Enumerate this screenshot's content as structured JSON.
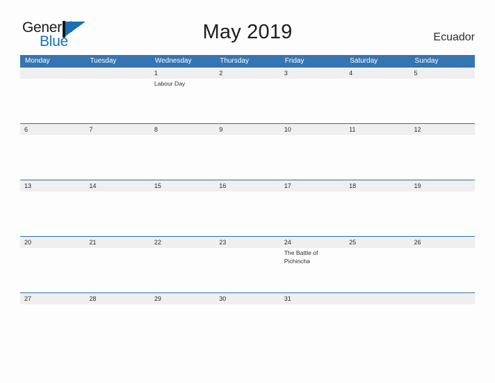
{
  "brand": {
    "word_one": "General",
    "word_two": "Blue",
    "mark_icon": "flag-triangle-icon",
    "accent_color": "#1271bd",
    "dark_color": "#17181c"
  },
  "header": {
    "title": "May 2019",
    "country": "Ecuador"
  },
  "theme": {
    "header_bar_color": "#3575b3",
    "row_rule_color": "#2e6da4",
    "band_color": "#efefef",
    "page_background": "#fdfdfd",
    "text_color": "#2b2b2b"
  },
  "calendar": {
    "weekdays": [
      "Monday",
      "Tuesday",
      "Wednesday",
      "Thursday",
      "Friday",
      "Saturday",
      "Sunday"
    ],
    "weeks": [
      {
        "band_span": 7,
        "days": [
          {
            "num": "",
            "event": ""
          },
          {
            "num": "",
            "event": ""
          },
          {
            "num": "1",
            "event": "Labour Day"
          },
          {
            "num": "2",
            "event": ""
          },
          {
            "num": "3",
            "event": ""
          },
          {
            "num": "4",
            "event": ""
          },
          {
            "num": "5",
            "event": ""
          }
        ]
      },
      {
        "band_span": 7,
        "days": [
          {
            "num": "6",
            "event": ""
          },
          {
            "num": "7",
            "event": ""
          },
          {
            "num": "8",
            "event": ""
          },
          {
            "num": "9",
            "event": ""
          },
          {
            "num": "10",
            "event": ""
          },
          {
            "num": "11",
            "event": ""
          },
          {
            "num": "12",
            "event": ""
          }
        ]
      },
      {
        "band_span": 7,
        "days": [
          {
            "num": "13",
            "event": ""
          },
          {
            "num": "14",
            "event": ""
          },
          {
            "num": "15",
            "event": ""
          },
          {
            "num": "16",
            "event": ""
          },
          {
            "num": "17",
            "event": ""
          },
          {
            "num": "18",
            "event": ""
          },
          {
            "num": "19",
            "event": ""
          }
        ]
      },
      {
        "band_span": 7,
        "days": [
          {
            "num": "20",
            "event": ""
          },
          {
            "num": "21",
            "event": ""
          },
          {
            "num": "22",
            "event": ""
          },
          {
            "num": "23",
            "event": ""
          },
          {
            "num": "24",
            "event": "The Battle of Pichincha"
          },
          {
            "num": "25",
            "event": ""
          },
          {
            "num": "26",
            "event": ""
          }
        ]
      },
      {
        "band_span": 7,
        "days": [
          {
            "num": "27",
            "event": ""
          },
          {
            "num": "28",
            "event": ""
          },
          {
            "num": "29",
            "event": ""
          },
          {
            "num": "30",
            "event": ""
          },
          {
            "num": "31",
            "event": ""
          },
          {
            "num": "",
            "event": ""
          },
          {
            "num": "",
            "event": ""
          }
        ]
      }
    ]
  }
}
